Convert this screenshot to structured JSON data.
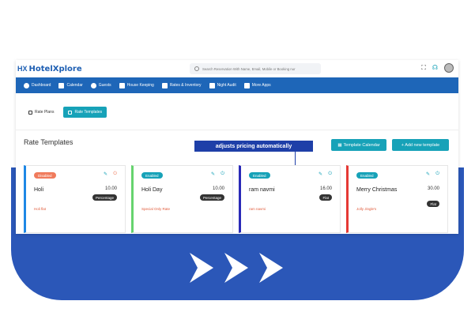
{
  "colors": {
    "brand": "#1e5fb3",
    "nav_bg": "#1e66b8",
    "teal": "#17a2b8",
    "tooltip_bg": "#1e3fa8",
    "backdrop": "#2b57b8",
    "disabled": "#f07b5c",
    "enabled": "#17a2b8"
  },
  "header": {
    "logo_mark": "HX",
    "logo_text": "HotelXplore",
    "search_placeholder": "Search Reservation With Name, Email, Mobile or Booking nur",
    "icons": [
      "fullscreen-icon",
      "headset-icon",
      "avatar"
    ]
  },
  "nav": {
    "items": [
      {
        "label": "Dashboard",
        "icon": "dashboard-icon"
      },
      {
        "label": "Calendar",
        "icon": "calendar-icon"
      },
      {
        "label": "Guests",
        "icon": "user-icon"
      },
      {
        "label": "House Keeping",
        "icon": "broom-icon"
      },
      {
        "label": "Rates & Inventory",
        "icon": "grid-icon"
      },
      {
        "label": "Night Audit",
        "icon": "moon-icon"
      },
      {
        "label": "More Apps",
        "icon": "apps-icon"
      }
    ]
  },
  "tabs": [
    {
      "label": "Rate Plans",
      "active": false
    },
    {
      "label": "Rate Templates",
      "active": true
    }
  ],
  "panel": {
    "title": "Rate Templates",
    "tooltip": "adjusts pricing automatically",
    "calendar_button": "Template Calendar",
    "add_button": "+ Add new template"
  },
  "cards": [
    {
      "status": "Disabled",
      "name": "Holi",
      "price": "10.00",
      "type": "Percentage",
      "desc": "Holi flat",
      "accent": "#1e88e5"
    },
    {
      "status": "Enabled",
      "name": "Holi Day",
      "price": "10.00",
      "type": "Percentage",
      "desc": "Special Only Rate",
      "accent": "#66d36e"
    },
    {
      "status": "Enabled",
      "name": "ram navmi",
      "price": "16.00",
      "type": "Flat",
      "desc": "ram navmi",
      "accent": "#2a2ab8"
    },
    {
      "status": "Enabled",
      "name": "Merry Christmas",
      "price": "30.00",
      "type": "Flat",
      "desc": "Jolly Jingle's",
      "accent": "#e53935"
    }
  ]
}
